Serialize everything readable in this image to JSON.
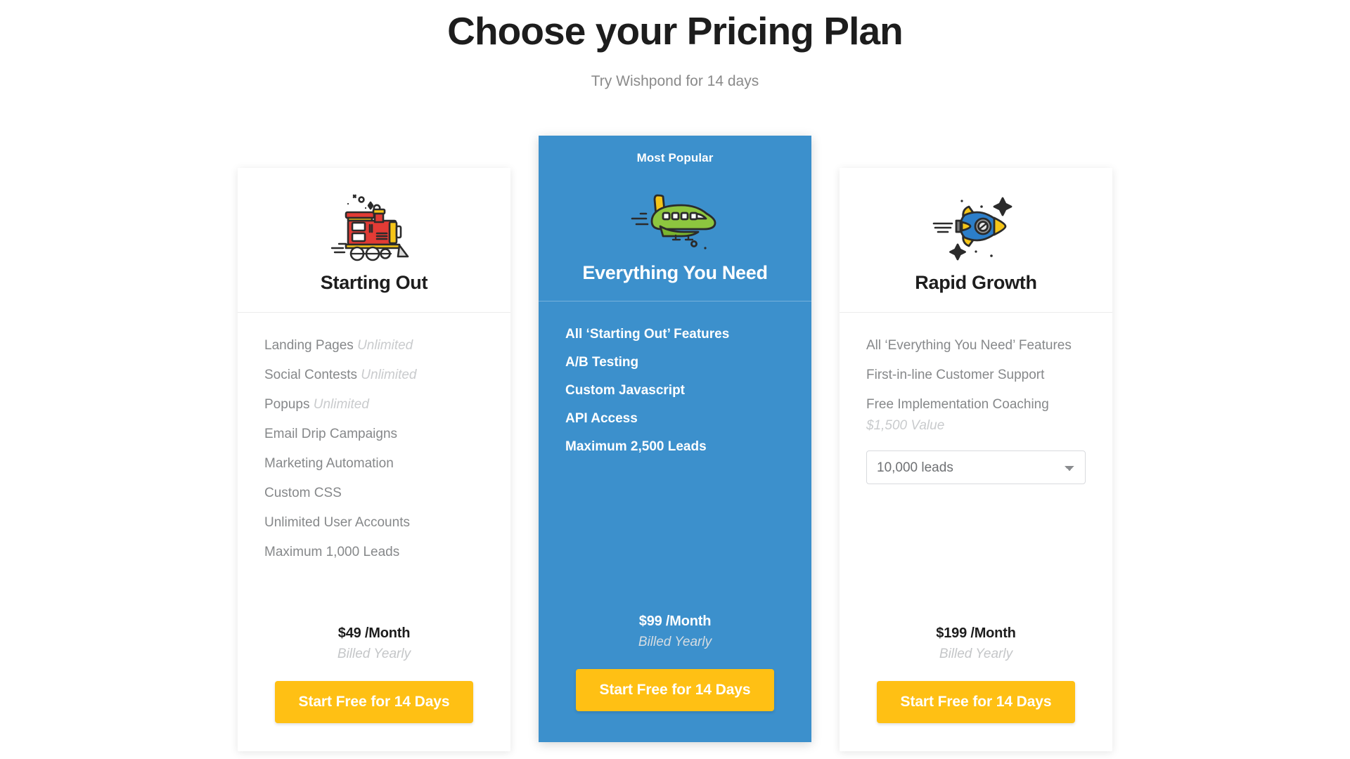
{
  "header": {
    "title": "Choose your Pricing Plan",
    "subtitle": "Try Wishpond for 14 days"
  },
  "plans": [
    {
      "id": "starting-out",
      "name": "Starting Out",
      "icon": "train-icon",
      "badge": "",
      "features": [
        {
          "label": "Landing Pages",
          "muted": "Unlimited"
        },
        {
          "label": "Social Contests",
          "muted": "Unlimited"
        },
        {
          "label": "Popups",
          "muted": "Unlimited"
        },
        {
          "label": "Email Drip Campaigns",
          "muted": ""
        },
        {
          "label": "Marketing Automation",
          "muted": ""
        },
        {
          "label": "Custom CSS",
          "muted": ""
        },
        {
          "label": "Unlimited User Accounts",
          "muted": ""
        },
        {
          "label": "Maximum 1,000 Leads",
          "muted": ""
        }
      ],
      "sub_note": "",
      "select": null,
      "price": "$49 /Month",
      "billing": "Billed Yearly",
      "cta": "Start Free for 14 Days"
    },
    {
      "id": "everything-you-need",
      "name": "Everything You Need",
      "icon": "airplane-icon",
      "badge": "Most Popular",
      "features": [
        {
          "label": "All ‘Starting Out’ Features",
          "muted": ""
        },
        {
          "label": "A/B Testing",
          "muted": ""
        },
        {
          "label": "Custom Javascript",
          "muted": ""
        },
        {
          "label": "API Access",
          "muted": ""
        },
        {
          "label": "Maximum 2,500 Leads",
          "muted": ""
        }
      ],
      "sub_note": "",
      "select": null,
      "price": "$99 /Month",
      "billing": "Billed Yearly",
      "cta": "Start Free for 14 Days"
    },
    {
      "id": "rapid-growth",
      "name": "Rapid Growth",
      "icon": "rocket-icon",
      "badge": "",
      "features": [
        {
          "label": "All ‘Everything You Need’ Features",
          "muted": ""
        },
        {
          "label": "First-in-line Customer Support",
          "muted": ""
        },
        {
          "label": "Free Implementation Coaching",
          "muted": ""
        }
      ],
      "sub_note": "$1,500 Value",
      "select": {
        "value": "10,000 leads",
        "options": [
          "10,000 leads"
        ]
      },
      "price": "$199 /Month",
      "billing": "Billed Yearly",
      "cta": "Start Free for 14 Days"
    }
  ],
  "colors": {
    "featured_background": "#3c90cc",
    "cta_background": "#ffc014",
    "title_text": "#1d1d1d",
    "body_text": "#86888a",
    "muted_text": "#c9cbcd"
  }
}
